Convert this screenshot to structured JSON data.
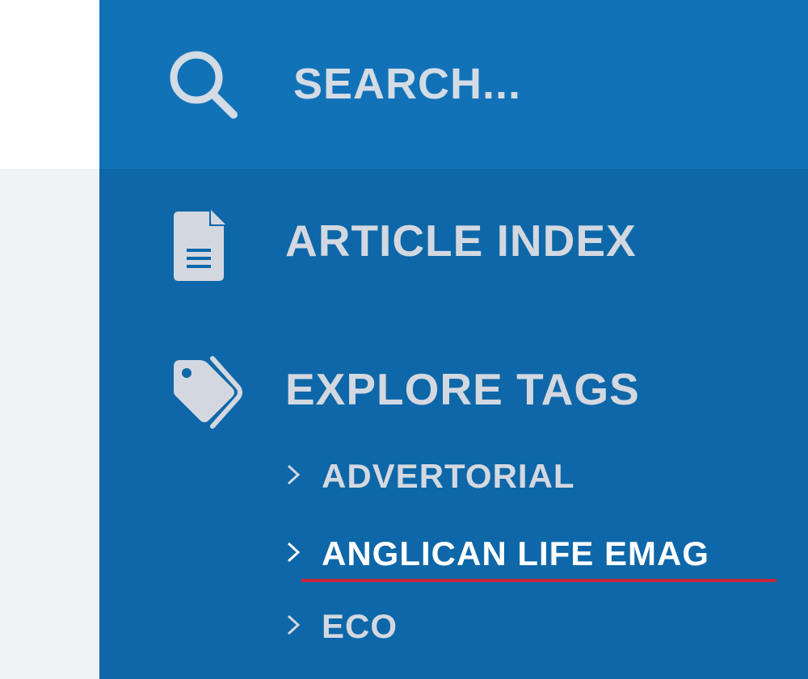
{
  "search": {
    "placeholder": "SEARCH...",
    "icon": "search-icon"
  },
  "menu": {
    "items": [
      {
        "label": "ARTICLE INDEX",
        "icon": "document-icon"
      },
      {
        "label": "EXPLORE TAGS",
        "icon": "tags-icon"
      }
    ]
  },
  "tags": {
    "items": [
      {
        "label": "ADVERTORIAL",
        "active": false
      },
      {
        "label": "ANGLICAN LIFE EMAG",
        "active": true
      },
      {
        "label": "ECO",
        "active": false
      }
    ]
  },
  "colors": {
    "panel": "#0e67a8",
    "search_bar": "#1272b8",
    "text_muted": "#d3d8e0",
    "text_active": "#ffffff",
    "active_underline": "#c8253a"
  }
}
